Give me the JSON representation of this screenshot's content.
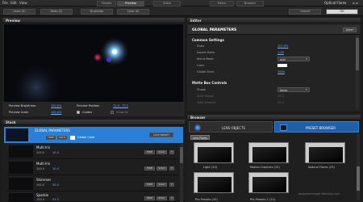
{
  "menu": [
    "File",
    "Edit",
    "View"
  ],
  "window_title": "Optical Flares",
  "tabs": [
    {
      "label": "Presets"
    },
    {
      "label": "Preview"
    },
    {
      "label": "Stack"
    },
    {
      "label": "Editor"
    },
    {
      "label": "Browser"
    }
  ],
  "toolbar": {
    "undo": "Undo (S)",
    "redo": "Redo (0)",
    "duplicate": "Duplicate",
    "clear_all": "Clear All",
    "cancel": "Cancel",
    "ok": "OK"
  },
  "preview": {
    "title": "Preview",
    "brightness_label": "Preview Brightness",
    "brightness_value": "100.0%",
    "scale_label": "Preview Scale",
    "scale_value": "100.0%",
    "position_label": "Preview Position",
    "position_value": "71.9 , 73.1",
    "guides_label": "Guides",
    "show_all_label": "Show All"
  },
  "stack": {
    "title": "Stack",
    "global_label": "GLOBAL PARAMETERS",
    "global_hide": "HIDE",
    "global_solo": "SOLO",
    "global_color_label": "Global Color",
    "save_preset": "SAVE PRESET",
    "items": [
      {
        "name": "Multi Iris",
        "val1": "100.0",
        "val2": "10.0"
      },
      {
        "name": "Multi Iris",
        "val1": "100.0",
        "val2": "10.0"
      },
      {
        "name": "Shimmer",
        "val1": "100.0",
        "val2": "95.0"
      },
      {
        "name": "Sparkle",
        "val1": "100.0",
        "val2": "51.0"
      }
    ],
    "hide": "HIDE",
    "solo": "SOLO"
  },
  "editor": {
    "title": "Editor",
    "header": "GLOBAL PARAMETERS",
    "reset": "RESET",
    "common_title": "Common Settings",
    "rows": [
      {
        "label": "Scale",
        "value": "107.0%"
      },
      {
        "label": "Aspect Ratio",
        "value": "1.00"
      },
      {
        "label": "Blend Mode",
        "value": "Add"
      },
      {
        "label": "Color",
        "value": ""
      },
      {
        "label": "Global Seed",
        "value": "3000"
      }
    ],
    "matte_title": "Matte Box Controls",
    "matte_rows": [
      {
        "label": "Shape",
        "value": "None"
      },
      {
        "label": "Start Range",
        "value": "20.0"
      },
      {
        "label": "Total Amount",
        "value": "50.0"
      }
    ]
  },
  "browser": {
    "title": "Browser",
    "tab_lens": "LENS OBJECTS",
    "tab_preset": "PRESET BROWSER",
    "crumb": "Lens Flares",
    "folders": [
      {
        "name": "Light (20)"
      },
      {
        "name": "Motion Graphics (15)"
      },
      {
        "name": "Natural Flares (23)"
      },
      {
        "name": "Pro Presets (10)"
      },
      {
        "name": "Pro Presets 2 (10)"
      }
    ],
    "watermark": "www.exchanger.tfloralus.com"
  },
  "colors": {
    "accent": "#2a7fd6",
    "selected_tab": "#1e5fa8",
    "link": "#6fb0ff"
  }
}
